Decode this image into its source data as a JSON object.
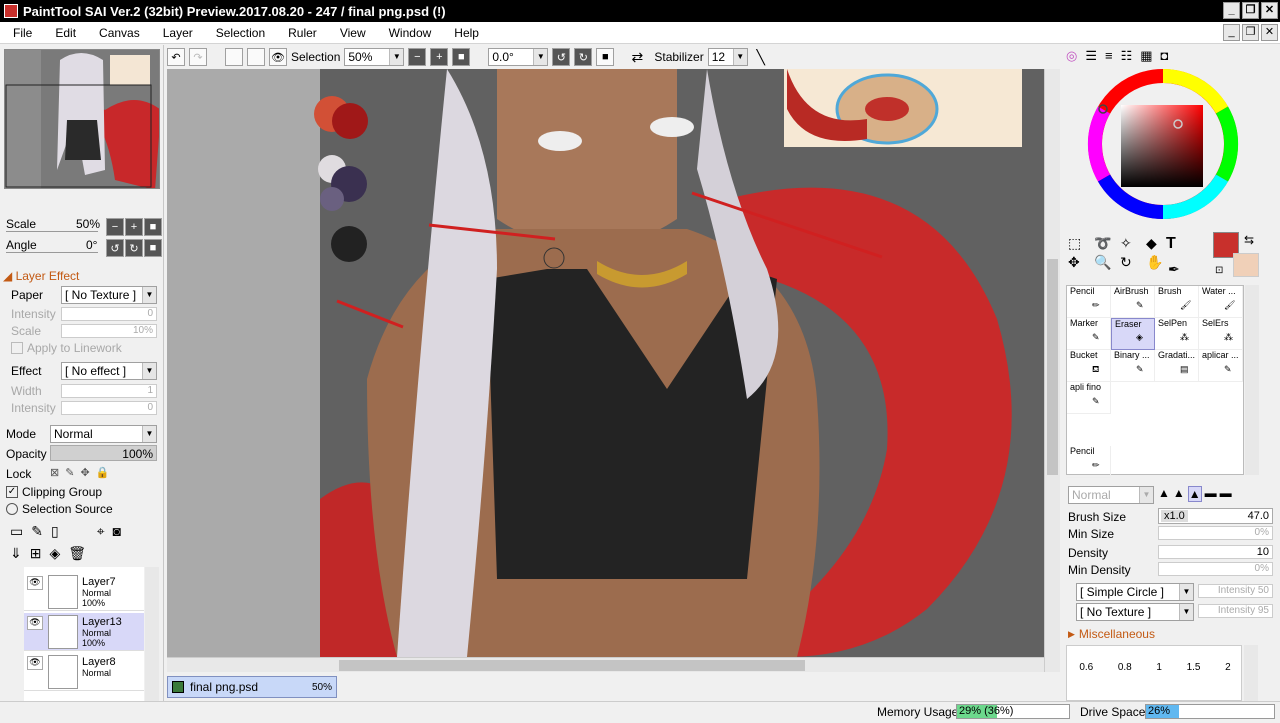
{
  "window": {
    "title": "PaintTool SAI Ver.2 (32bit) Preview.2017.08.20 - 247 / final png.psd (!)",
    "btn_minimize": "_",
    "btn_restore": "❐",
    "btn_close": "✕",
    "mdi_minimize": "_",
    "mdi_restore": "❐",
    "mdi_close": "✕"
  },
  "menu": [
    "File",
    "Edit",
    "Canvas",
    "Layer",
    "Selection",
    "Ruler",
    "View",
    "Window",
    "Help"
  ],
  "toolbar": {
    "selection_label": "Selection",
    "zoom": "50%",
    "rotation": "0.0°",
    "stabilizer_label": "Stabilizer",
    "stabilizer_value": "12"
  },
  "navigator": {
    "scale_label": "Scale",
    "scale_value": "50%",
    "angle_label": "Angle",
    "angle_value": "0°"
  },
  "layer_effect": {
    "header": "Layer Effect",
    "paper_label": "Paper",
    "paper_value": "[ No Texture ]",
    "intensity_label": "Intensity",
    "intensity_value": "0",
    "scale_label": "Scale",
    "scale_value": "10%",
    "apply_linework": "Apply to Linework",
    "effect_label": "Effect",
    "effect_value": "[ No effect ]",
    "width_label": "Width",
    "width_value": "1",
    "intensity2_label": "Intensity",
    "intensity2_value": "0"
  },
  "layer_props": {
    "mode_label": "Mode",
    "mode_value": "Normal",
    "opacity_label": "Opacity",
    "opacity_value": "100%",
    "opacity_fraction": 1.0,
    "lock_label": "Lock",
    "clipping_group": "Clipping Group",
    "selection_source": "Selection Source"
  },
  "layers": [
    {
      "name": "Layer7",
      "mode": "Normal",
      "opacity": "100%",
      "selected": false
    },
    {
      "name": "Layer13",
      "mode": "Normal",
      "opacity": "100%",
      "selected": true
    },
    {
      "name": "Layer8",
      "mode": "Normal",
      "opacity": "",
      "selected": false
    }
  ],
  "document_tab": {
    "name": "final png.psd",
    "zoom": "50%"
  },
  "tools": [
    {
      "name": "Pencil",
      "selected": false
    },
    {
      "name": "AirBrush",
      "selected": false
    },
    {
      "name": "Brush",
      "selected": false
    },
    {
      "name": "Water ...",
      "selected": false
    },
    {
      "name": "Marker",
      "selected": false
    },
    {
      "name": "Eraser",
      "selected": true
    },
    {
      "name": "SelPen",
      "selected": false
    },
    {
      "name": "SelErs",
      "selected": false
    },
    {
      "name": "Bucket",
      "selected": false
    },
    {
      "name": "Binary ...",
      "selected": false
    },
    {
      "name": "Gradati...",
      "selected": false
    },
    {
      "name": "aplicar ...",
      "selected": false
    },
    {
      "name": "apli fino",
      "selected": false
    },
    {
      "name": "Pencil",
      "selected": false
    }
  ],
  "brush": {
    "blend_mode": "Normal",
    "size_label": "Brush Size",
    "size_mult": "x1.0",
    "size_value": "47.0",
    "min_size_label": "Min Size",
    "min_size_value": "0%",
    "density_label": "Density",
    "density_value": "10",
    "min_density_label": "Min Density",
    "min_density_value": "0%",
    "shape": "[ Simple Circle ]",
    "shape_intensity": "Intensity 50",
    "texture": "[ No Texture ]",
    "texture_intensity": "Intensity 95",
    "misc_label": "Miscellaneous",
    "presets": [
      "0.6",
      "0.8",
      "1",
      "1.5",
      "2"
    ]
  },
  "colors": {
    "primary": "#c8302c",
    "secondary": "#f0d0b8",
    "accent_title": "#000000",
    "selection_highlight": "#d8d8f8"
  },
  "status": {
    "memory_label": "Memory Usage",
    "memory_value": "29% (36%)",
    "memory_fraction": 0.36,
    "drive_label": "Drive Space",
    "drive_value": "26%",
    "drive_fraction": 0.26
  }
}
